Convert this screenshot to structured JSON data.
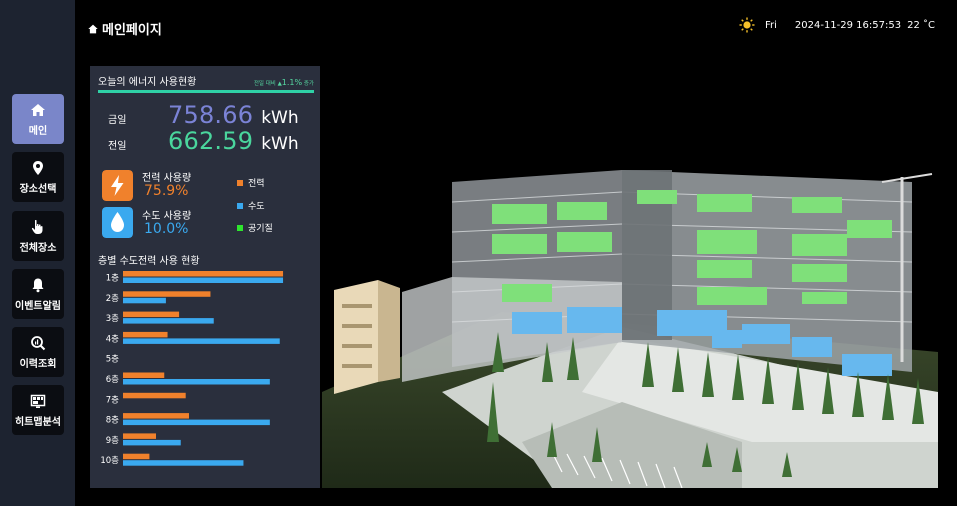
{
  "sidebar": {
    "items": [
      {
        "label": "메인",
        "icon": "home-icon",
        "active": true
      },
      {
        "label": "장소선택",
        "icon": "location-pin-icon",
        "active": false
      },
      {
        "label": "전체장소",
        "icon": "hand-pointer-icon",
        "active": false
      },
      {
        "label": "이벤트알림",
        "icon": "bell-icon",
        "active": false
      },
      {
        "label": "이력조회",
        "icon": "history-search-icon",
        "active": false
      },
      {
        "label": "히트맵분석",
        "icon": "heatmap-icon",
        "active": false
      }
    ]
  },
  "header": {
    "title": "메인페이지",
    "weekday": "Fri",
    "datetime": "2024-11-29 16:57:53",
    "temperature": "22 ˚C",
    "weather_icon": "sun-icon"
  },
  "energy": {
    "title": "오늘의 에너지 사용현황",
    "compare_prefix": "전일 대비 ▲",
    "compare_value": "1.1%",
    "compare_suffix": " 증가",
    "today_label": "금일",
    "today_value": "758.66",
    "yesterday_label": "전일",
    "yesterday_value": "662.59",
    "unit": "kWh",
    "colors": {
      "today": "#7b83d6",
      "yesterday": "#4ad69d",
      "accent": "#2fd1a6"
    }
  },
  "usage": {
    "power_label": "전력 사용량",
    "power_value": "75.9%",
    "water_label": "수도 사용량",
    "water_value": "10.0%"
  },
  "legend": [
    {
      "label": "전력",
      "color": "#f0812c"
    },
    {
      "label": "수도",
      "color": "#3aa9ef"
    },
    {
      "label": "공기질",
      "color": "#2ee62e"
    }
  ],
  "chart_data": {
    "type": "bar",
    "title": "층별 수도전력 사용 현황",
    "categories": [
      "1층",
      "2층",
      "3층",
      "4층",
      "5층",
      "6층",
      "7층",
      "8층",
      "9층",
      "10층"
    ],
    "series": [
      {
        "name": "전력",
        "color": "#f0812c",
        "values": [
          97,
          53,
          34,
          27,
          0,
          25,
          38,
          40,
          20,
          16
        ]
      },
      {
        "name": "수도",
        "color": "#3aa9ef",
        "values": [
          97,
          26,
          55,
          95,
          0,
          89,
          0,
          89,
          35,
          73
        ]
      }
    ],
    "ylim": [
      0,
      100
    ]
  }
}
